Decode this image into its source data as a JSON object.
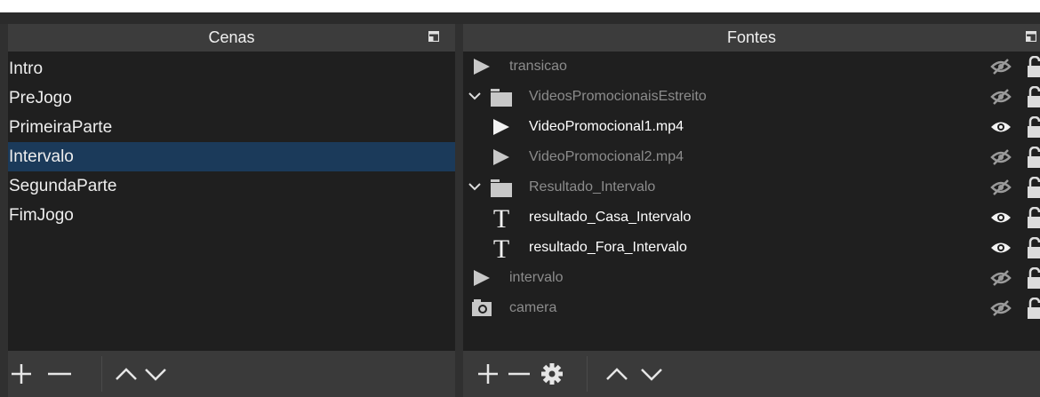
{
  "scenes": {
    "title": "Cenas",
    "items": [
      {
        "label": "Intro",
        "selected": false
      },
      {
        "label": "PreJogo",
        "selected": false
      },
      {
        "label": "PrimeiraParte",
        "selected": false
      },
      {
        "label": "Intervalo",
        "selected": true
      },
      {
        "label": "SegundaParte",
        "selected": false
      },
      {
        "label": "FimJogo",
        "selected": false
      }
    ]
  },
  "sources": {
    "title": "Fontes",
    "items": [
      {
        "label": "transicao",
        "icon": "media-play-icon",
        "visible": false,
        "indent": 0,
        "group": false
      },
      {
        "label": "VideosPromocionaisEstreito",
        "icon": "folder-icon",
        "visible": false,
        "indent": 0,
        "group": true
      },
      {
        "label": "VideoPromocional1.mp4",
        "icon": "media-play-icon",
        "visible": true,
        "indent": 1,
        "group": false
      },
      {
        "label": "VideoPromocional2.mp4",
        "icon": "media-play-icon",
        "visible": false,
        "indent": 1,
        "group": false
      },
      {
        "label": "Resultado_Intervalo",
        "icon": "folder-icon",
        "visible": false,
        "indent": 0,
        "group": true
      },
      {
        "label": "resultado_Casa_Intervalo",
        "icon": "text-icon",
        "visible": true,
        "indent": 1,
        "group": false
      },
      {
        "label": "resultado_Fora_Intervalo",
        "icon": "text-icon",
        "visible": true,
        "indent": 1,
        "group": false
      },
      {
        "label": "intervalo",
        "icon": "media-play-icon",
        "visible": false,
        "indent": 0,
        "group": false
      },
      {
        "label": "camera",
        "icon": "camera-icon",
        "visible": false,
        "indent": 0,
        "group": false
      }
    ]
  },
  "colors": {
    "panel_bg": "#1f1f1f",
    "header_bg": "#3c3c3c",
    "selected_bg": "#1b3a5a",
    "hidden_text": "#8c8c8c"
  }
}
